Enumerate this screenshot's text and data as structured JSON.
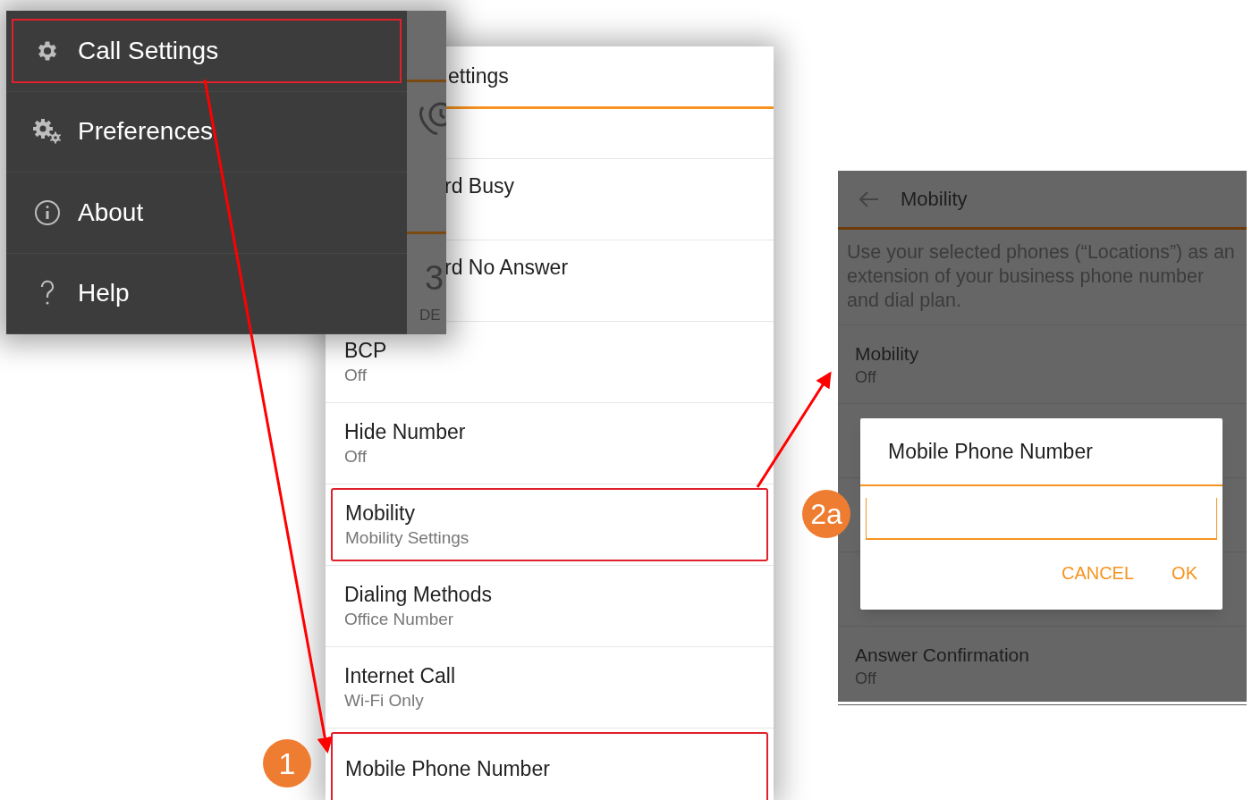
{
  "drawer": {
    "items": [
      {
        "label": "Call Settings",
        "kind": "gear",
        "highlighted": true
      },
      {
        "label": "Preferences",
        "kind": "gears",
        "highlighted": false
      },
      {
        "label": "About",
        "kind": "info",
        "highlighted": false
      },
      {
        "label": "Help",
        "kind": "question",
        "highlighted": false
      }
    ],
    "edge": {
      "number": "3",
      "label": "DE"
    }
  },
  "settings": {
    "title": "ettings",
    "rows": [
      {
        "title": "rd Busy",
        "partial": true,
        "highlighted": false
      },
      {
        "title": "rd No Answer",
        "partial": true,
        "highlighted": false
      },
      {
        "title": "BCP",
        "value": "Off",
        "partial": false,
        "highlighted": false
      },
      {
        "title": "Hide Number",
        "value": "Off",
        "partial": false,
        "highlighted": false
      },
      {
        "title": "Mobility",
        "value": "Mobility Settings",
        "partial": false,
        "highlighted": true
      },
      {
        "title": "Dialing Methods",
        "value": "Office Number",
        "partial": false,
        "highlighted": false
      },
      {
        "title": "Internet Call",
        "value": "Wi-Fi Only",
        "partial": false,
        "highlighted": false
      },
      {
        "title": "Mobile Phone Number",
        "partial": false,
        "highlighted": true
      }
    ]
  },
  "mobility": {
    "title": "Mobility",
    "description": "Use your selected phones (“Locations”) as an extension of your business phone number and dial plan.",
    "rows": [
      {
        "title": "Mobility",
        "value": "Off"
      },
      {
        "title": "Answer Confirmation",
        "value": "Off"
      }
    ],
    "dialog": {
      "title": "Mobile Phone Number",
      "buttons": [
        "CANCEL",
        "OK"
      ]
    }
  },
  "callouts": [
    {
      "label": "1"
    },
    {
      "label": "2a"
    }
  ]
}
